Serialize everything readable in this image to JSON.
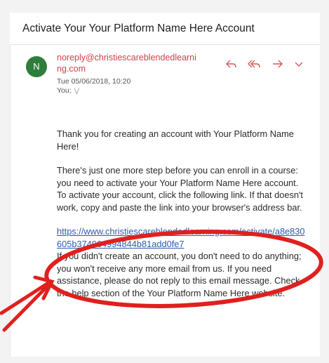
{
  "email": {
    "subject": "Activate Your Your Platform Name Here Account",
    "avatar_letter": "N",
    "sender": "noreply@christiescareblendedlearning.com",
    "date": "Tue 05/06/2018, 10:20",
    "to": "You;",
    "actions": [
      "reply-icon",
      "reply-all-icon",
      "forward-icon",
      "chevron-down-icon"
    ],
    "body": {
      "p1": "Thank you for creating an account with Your Platform Name Here!",
      "p2": "There's just one more step before you can enroll in a course: you need to activate your Your Platform Name Here account. To activate your account, click the following link. If that doesn't work, copy and paste the link into your browser's address bar.",
      "link": "https://www.christiescareblendedlearning.com/activate/a8e830605b374964994844b81add0fe7",
      "p3": "If you didn't create an account, you don't need to do anything; you won't receive any more email from us. If you need assistance, please do not reply to this email message. Check the help section of the Your Platform Name Here website."
    }
  },
  "annotation": {
    "ellipse_color": "#e0201e",
    "arrow_color": "#e0201e"
  }
}
